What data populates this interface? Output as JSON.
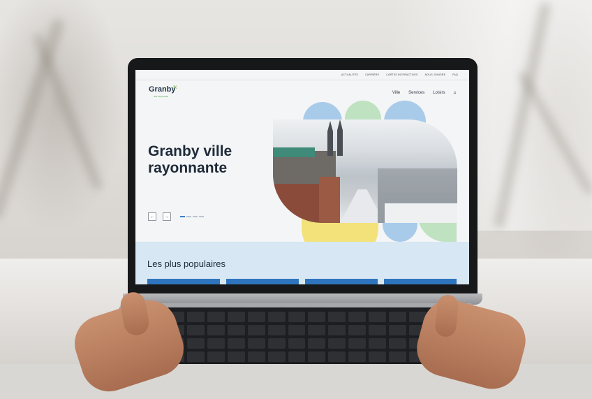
{
  "site": {
    "utility_nav": [
      "ACTUALITÉS",
      "CARRIÈRE",
      "CARTES INTERACTIVES",
      "NOUS JOINDRE",
      "FAQ"
    ],
    "logo_text": "Granby",
    "logo_tagline": "ville rayonnante",
    "main_nav": [
      "Ville",
      "Services",
      "Loisirs"
    ],
    "search_glyph": "⌕",
    "hero_title": "Granby ville rayonnante",
    "prev_glyph": "←",
    "next_glyph": "→",
    "slides_count": 4,
    "active_slide": 1,
    "popular_title": "Les plus populaires",
    "popular_tiles_count": 4
  },
  "colors": {
    "brand_navy": "#23364a",
    "brand_green": "#6ab24a",
    "accent_blue": "#2f74be",
    "popular_bg": "#d7e7f3",
    "shape_blue": "#a9cbea",
    "shape_green": "#bfe2c0",
    "shape_yellow": "#f3e27a"
  }
}
